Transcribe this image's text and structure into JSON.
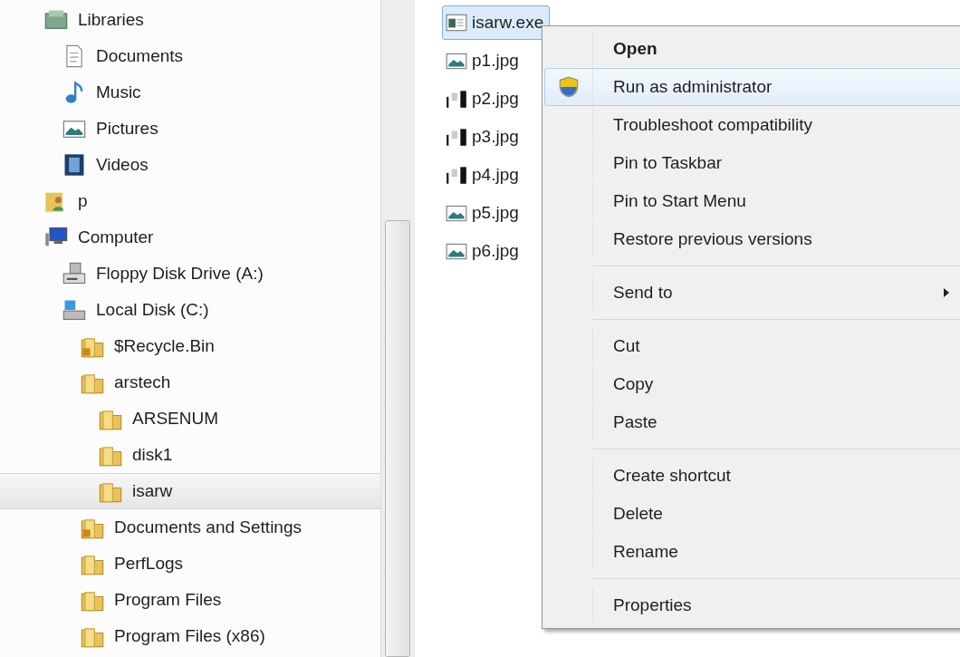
{
  "tree": [
    {
      "label": "Libraries",
      "kind": "libraries",
      "selected": false,
      "children": [
        {
          "label": "Documents",
          "kind": "document",
          "selected": false
        },
        {
          "label": "Music",
          "kind": "music",
          "selected": false
        },
        {
          "label": "Pictures",
          "kind": "picture",
          "selected": false
        },
        {
          "label": "Videos",
          "kind": "video",
          "selected": false
        }
      ]
    },
    {
      "label": "p",
      "kind": "user",
      "selected": false
    },
    {
      "label": "Computer",
      "kind": "computer",
      "selected": false,
      "children": [
        {
          "label": "Floppy Disk Drive (A:)",
          "kind": "floppy",
          "selected": false
        },
        {
          "label": "Local Disk (C:)",
          "kind": "disk",
          "selected": false,
          "children": [
            {
              "label": "$Recycle.Bin",
              "kind": "locked-folder",
              "selected": false
            },
            {
              "label": "arstech",
              "kind": "folder",
              "selected": false,
              "children": [
                {
                  "label": "ARSENUM",
                  "kind": "folder",
                  "selected": false
                },
                {
                  "label": "disk1",
                  "kind": "folder",
                  "selected": false
                },
                {
                  "label": "isarw",
                  "kind": "folder",
                  "selected": true
                }
              ]
            },
            {
              "label": "Documents and Settings",
              "kind": "locked-folder",
              "selected": false
            },
            {
              "label": "PerfLogs",
              "kind": "folder",
              "selected": false
            },
            {
              "label": "Program Files",
              "kind": "folder",
              "selected": false
            },
            {
              "label": "Program Files (x86)",
              "kind": "folder",
              "selected": false
            }
          ]
        }
      ]
    }
  ],
  "files": [
    {
      "name": "isarw.exe",
      "kind": "exe",
      "selected": true
    },
    {
      "name": "p1.jpg",
      "kind": "picture",
      "selected": false
    },
    {
      "name": "p2.jpg",
      "kind": "thumbnail",
      "selected": false
    },
    {
      "name": "p3.jpg",
      "kind": "thumbnail",
      "selected": false
    },
    {
      "name": "p4.jpg",
      "kind": "thumbnail",
      "selected": false
    },
    {
      "name": "p5.jpg",
      "kind": "picture",
      "selected": false
    },
    {
      "name": "p6.jpg",
      "kind": "picture",
      "selected": false
    }
  ],
  "context_menu": [
    {
      "kind": "item",
      "label": "Open",
      "default": true,
      "selected": false
    },
    {
      "kind": "shield-item",
      "label": "Run as administrator",
      "default": false,
      "selected": true
    },
    {
      "kind": "item",
      "label": "Troubleshoot compatibility",
      "default": false,
      "selected": false
    },
    {
      "kind": "item",
      "label": "Pin to Taskbar",
      "default": false,
      "selected": false
    },
    {
      "kind": "item",
      "label": "Pin to Start Menu",
      "default": false,
      "selected": false
    },
    {
      "kind": "item",
      "label": "Restore previous versions",
      "default": false,
      "selected": false
    },
    {
      "kind": "separator"
    },
    {
      "kind": "submenu-item",
      "label": "Send to",
      "default": false,
      "selected": false
    },
    {
      "kind": "separator"
    },
    {
      "kind": "item",
      "label": "Cut",
      "default": false,
      "selected": false
    },
    {
      "kind": "item",
      "label": "Copy",
      "default": false,
      "selected": false
    },
    {
      "kind": "item",
      "label": "Paste",
      "default": false,
      "selected": false
    },
    {
      "kind": "separator"
    },
    {
      "kind": "item",
      "label": "Create shortcut",
      "default": false,
      "selected": false
    },
    {
      "kind": "item",
      "label": "Delete",
      "default": false,
      "selected": false
    },
    {
      "kind": "item",
      "label": "Rename",
      "default": false,
      "selected": false
    },
    {
      "kind": "separator"
    },
    {
      "kind": "item",
      "label": "Properties",
      "default": false,
      "selected": false
    }
  ]
}
